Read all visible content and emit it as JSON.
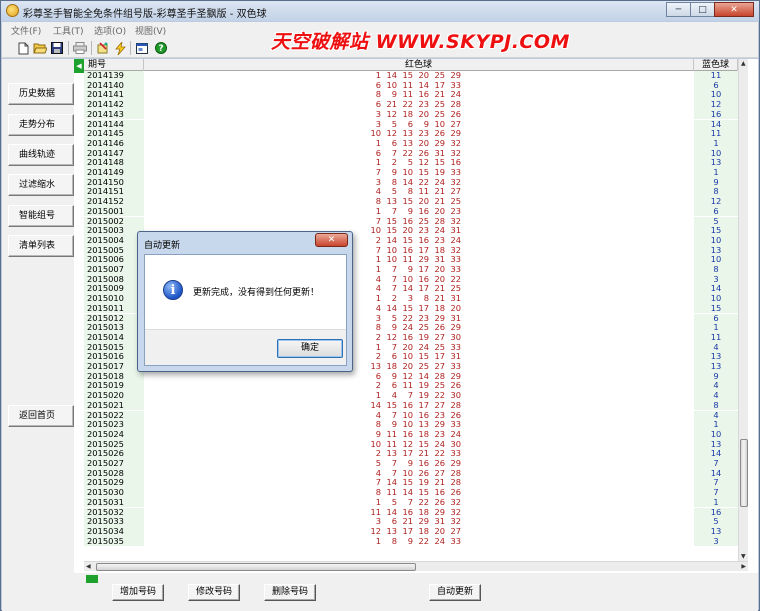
{
  "window": {
    "title": "彩尊圣手智能全免条件组号版-彩尊圣手圣飘版 - 双色球",
    "min_label": "─",
    "max_label": "□",
    "close_label": "✕"
  },
  "menu": [
    "文件(F)",
    "工具(T)",
    "选项(O)",
    "视图(V)"
  ],
  "watermark": "天空破解站 WWW.SKYPJ.COM",
  "toolbar_icons": [
    "new-file-icon",
    "open-folder-icon",
    "save-icon",
    "print-icon",
    "tool-icon",
    "lightning-icon",
    "window-icon",
    "help-icon"
  ],
  "sidebar": {
    "buttons": [
      "历史数据",
      "走势分布",
      "曲线轨迹",
      "过滤缩水",
      "智能组号",
      "清单列表"
    ],
    "back_button": "返回首页"
  },
  "grid": {
    "collapse_label": "◀",
    "headers": {
      "period": "期号",
      "red": "红色球",
      "blue": "蓝色球"
    },
    "rows": [
      {
        "period": "2014139",
        "reds": [
          "1",
          "14",
          "15",
          "20",
          "25",
          "29"
        ],
        "blue": "11"
      },
      {
        "period": "2014140",
        "reds": [
          "6",
          "10",
          "11",
          "14",
          "17",
          "33"
        ],
        "blue": "6"
      },
      {
        "period": "2014141",
        "reds": [
          "8",
          "9",
          "11",
          "16",
          "21",
          "24"
        ],
        "blue": "10"
      },
      {
        "period": "2014142",
        "reds": [
          "6",
          "21",
          "22",
          "23",
          "25",
          "28"
        ],
        "blue": "12"
      },
      {
        "period": "2014143",
        "reds": [
          "3",
          "12",
          "18",
          "20",
          "25",
          "26"
        ],
        "blue": "16"
      },
      {
        "period": "2014144",
        "reds": [
          "3",
          "5",
          "6",
          "9",
          "10",
          "27"
        ],
        "blue": "14"
      },
      {
        "period": "2014145",
        "reds": [
          "10",
          "12",
          "13",
          "23",
          "26",
          "29"
        ],
        "blue": "11"
      },
      {
        "period": "2014146",
        "reds": [
          "1",
          "6",
          "13",
          "20",
          "29",
          "32"
        ],
        "blue": "1"
      },
      {
        "period": "2014147",
        "reds": [
          "6",
          "7",
          "22",
          "26",
          "31",
          "32"
        ],
        "blue": "10"
      },
      {
        "period": "2014148",
        "reds": [
          "1",
          "2",
          "5",
          "12",
          "15",
          "16"
        ],
        "blue": "13"
      },
      {
        "period": "2014149",
        "reds": [
          "7",
          "9",
          "10",
          "15",
          "19",
          "33"
        ],
        "blue": "1"
      },
      {
        "period": "2014150",
        "reds": [
          "3",
          "8",
          "14",
          "22",
          "24",
          "32"
        ],
        "blue": "9"
      },
      {
        "period": "2014151",
        "reds": [
          "4",
          "5",
          "8",
          "11",
          "21",
          "27"
        ],
        "blue": "8"
      },
      {
        "period": "2014152",
        "reds": [
          "8",
          "13",
          "15",
          "20",
          "21",
          "25"
        ],
        "blue": "12"
      },
      {
        "period": "2015001",
        "reds": [
          "1",
          "7",
          "9",
          "16",
          "20",
          "23"
        ],
        "blue": "6"
      },
      {
        "period": "2015002",
        "reds": [
          "7",
          "15",
          "16",
          "25",
          "28",
          "32"
        ],
        "blue": "5"
      },
      {
        "period": "2015003",
        "reds": [
          "10",
          "15",
          "20",
          "23",
          "24",
          "31"
        ],
        "blue": "15"
      },
      {
        "period": "2015004",
        "reds": [
          "2",
          "14",
          "15",
          "16",
          "23",
          "24"
        ],
        "blue": "10"
      },
      {
        "period": "2015005",
        "reds": [
          "7",
          "10",
          "16",
          "17",
          "18",
          "32"
        ],
        "blue": "13"
      },
      {
        "period": "2015006",
        "reds": [
          "1",
          "10",
          "11",
          "29",
          "31",
          "33"
        ],
        "blue": "10"
      },
      {
        "period": "2015007",
        "reds": [
          "1",
          "7",
          "9",
          "17",
          "20",
          "33"
        ],
        "blue": "8"
      },
      {
        "period": "2015008",
        "reds": [
          "4",
          "7",
          "10",
          "16",
          "20",
          "22"
        ],
        "blue": "3"
      },
      {
        "period": "2015009",
        "reds": [
          "4",
          "7",
          "14",
          "17",
          "21",
          "25"
        ],
        "blue": "14"
      },
      {
        "period": "2015010",
        "reds": [
          "1",
          "2",
          "3",
          "8",
          "21",
          "31"
        ],
        "blue": "10"
      },
      {
        "period": "2015011",
        "reds": [
          "4",
          "14",
          "15",
          "17",
          "18",
          "20"
        ],
        "blue": "15"
      },
      {
        "period": "2015012",
        "reds": [
          "3",
          "5",
          "22",
          "23",
          "29",
          "31"
        ],
        "blue": "6"
      },
      {
        "period": "2015013",
        "reds": [
          "8",
          "9",
          "24",
          "25",
          "26",
          "29"
        ],
        "blue": "1"
      },
      {
        "period": "2015014",
        "reds": [
          "2",
          "12",
          "16",
          "19",
          "27",
          "30"
        ],
        "blue": "11"
      },
      {
        "period": "2015015",
        "reds": [
          "1",
          "7",
          "20",
          "24",
          "25",
          "33"
        ],
        "blue": "4"
      },
      {
        "period": "2015016",
        "reds": [
          "2",
          "6",
          "10",
          "15",
          "17",
          "31"
        ],
        "blue": "13"
      },
      {
        "period": "2015017",
        "reds": [
          "13",
          "18",
          "20",
          "25",
          "27",
          "33"
        ],
        "blue": "13"
      },
      {
        "period": "2015018",
        "reds": [
          "6",
          "9",
          "12",
          "14",
          "28",
          "29"
        ],
        "blue": "9"
      },
      {
        "period": "2015019",
        "reds": [
          "2",
          "6",
          "11",
          "19",
          "25",
          "26"
        ],
        "blue": "4"
      },
      {
        "period": "2015020",
        "reds": [
          "1",
          "4",
          "7",
          "19",
          "22",
          "30"
        ],
        "blue": "4"
      },
      {
        "period": "2015021",
        "reds": [
          "14",
          "15",
          "16",
          "17",
          "27",
          "28"
        ],
        "blue": "8"
      },
      {
        "period": "2015022",
        "reds": [
          "4",
          "7",
          "10",
          "16",
          "23",
          "26"
        ],
        "blue": "4"
      },
      {
        "period": "2015023",
        "reds": [
          "8",
          "9",
          "10",
          "13",
          "29",
          "33"
        ],
        "blue": "1"
      },
      {
        "period": "2015024",
        "reds": [
          "9",
          "11",
          "16",
          "18",
          "23",
          "24"
        ],
        "blue": "10"
      },
      {
        "period": "2015025",
        "reds": [
          "10",
          "11",
          "12",
          "15",
          "24",
          "30"
        ],
        "blue": "13"
      },
      {
        "period": "2015026",
        "reds": [
          "2",
          "13",
          "17",
          "21",
          "22",
          "33"
        ],
        "blue": "14"
      },
      {
        "period": "2015027",
        "reds": [
          "5",
          "7",
          "9",
          "16",
          "26",
          "29"
        ],
        "blue": "7"
      },
      {
        "period": "2015028",
        "reds": [
          "4",
          "7",
          "10",
          "26",
          "27",
          "28"
        ],
        "blue": "14"
      },
      {
        "period": "2015029",
        "reds": [
          "7",
          "14",
          "15",
          "19",
          "21",
          "28"
        ],
        "blue": "7"
      },
      {
        "period": "2015030",
        "reds": [
          "8",
          "11",
          "14",
          "15",
          "16",
          "26"
        ],
        "blue": "7"
      },
      {
        "period": "2015031",
        "reds": [
          "1",
          "5",
          "7",
          "22",
          "26",
          "32"
        ],
        "blue": "1"
      },
      {
        "period": "2015032",
        "reds": [
          "11",
          "14",
          "16",
          "18",
          "29",
          "32"
        ],
        "blue": "16"
      },
      {
        "period": "2015033",
        "reds": [
          "3",
          "6",
          "21",
          "29",
          "31",
          "32"
        ],
        "blue": "5"
      },
      {
        "period": "2015034",
        "reds": [
          "12",
          "13",
          "17",
          "18",
          "20",
          "27"
        ],
        "blue": "13"
      },
      {
        "period": "2015035",
        "reds": [
          "1",
          "8",
          "9",
          "22",
          "24",
          "33"
        ],
        "blue": "3"
      }
    ]
  },
  "bottom_buttons": {
    "add": "增加号码",
    "edit": "修改号码",
    "delete": "删除号码",
    "auto_update": "自动更新"
  },
  "dialog": {
    "title": "自动更新",
    "message": "更新完成，没有得到任何更新！",
    "ok_label": "确定",
    "icon": "info-icon",
    "close_label": "✕"
  },
  "colors": {
    "red_ball": "#b02020",
    "blue_ball": "#1a3aa8",
    "green_column": "#e9f6e9",
    "watermark": "#ee1010"
  }
}
